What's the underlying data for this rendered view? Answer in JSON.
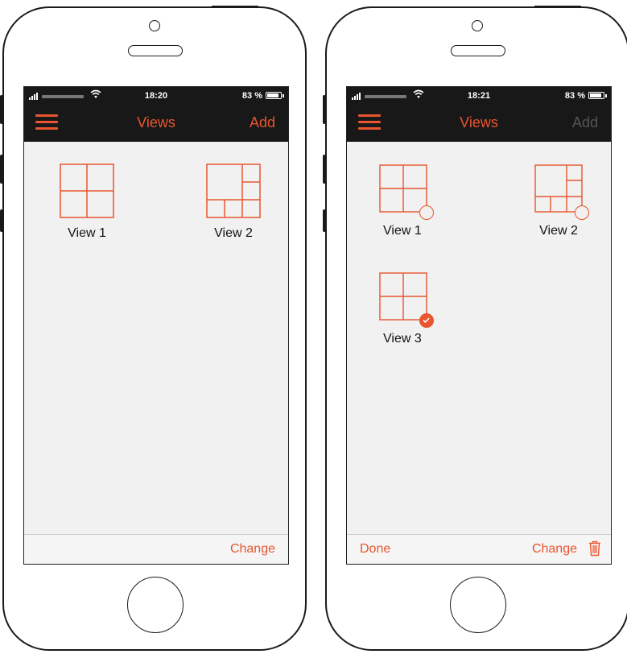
{
  "colors": {
    "accent": "#e8552f",
    "bar": "#181818",
    "screen_bg": "#f1f1f1"
  },
  "phones": [
    {
      "status": {
        "time": "18:20",
        "battery": "83 %"
      },
      "nav": {
        "title": "Views",
        "add_label": "Add",
        "add_enabled": true
      },
      "views": [
        {
          "label": "View 1",
          "layout": "2x2"
        },
        {
          "label": "View 2",
          "layout": "1+5"
        }
      ],
      "toolbar": {
        "done_label": "",
        "change_label": "Change",
        "trash_visible": false
      }
    },
    {
      "status": {
        "time": "18:21",
        "battery": "83 %"
      },
      "nav": {
        "title": "Views",
        "add_label": "Add",
        "add_enabled": false
      },
      "views": [
        {
          "label": "View 1",
          "layout": "2x2",
          "selected": false
        },
        {
          "label": "View 2",
          "layout": "1+5",
          "selected": false
        },
        {
          "label": "View 3",
          "layout": "2x2",
          "selected": true
        }
      ],
      "toolbar": {
        "done_label": "Done",
        "change_label": "Change",
        "trash_visible": true
      }
    }
  ]
}
